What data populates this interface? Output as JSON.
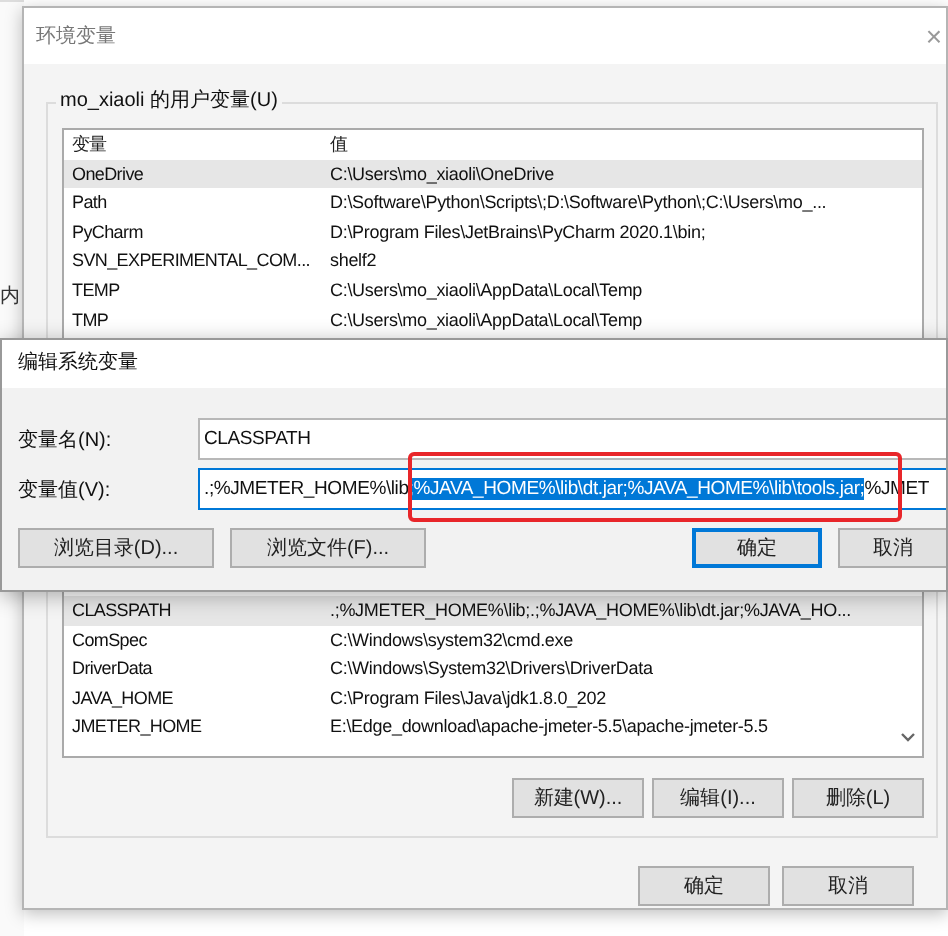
{
  "background_window": {
    "text": "内"
  },
  "env_window": {
    "title": "环境变量",
    "close": "×",
    "user_group": {
      "label": "mo_xiaoli 的用户变量(U)",
      "columns": [
        "变量",
        "值"
      ],
      "rows": [
        {
          "name": "OneDrive",
          "value": "C:\\Users\\mo_xiaoli\\OneDrive",
          "selected": true
        },
        {
          "name": "Path",
          "value": "D:\\Software\\Python\\Scripts\\;D:\\Software\\Python\\;C:\\Users\\mo_...",
          "selected": false
        },
        {
          "name": "PyCharm",
          "value": "D:\\Program Files\\JetBrains\\PyCharm 2020.1\\bin;",
          "selected": false
        },
        {
          "name": "SVN_EXPERIMENTAL_COM...",
          "value": "shelf2",
          "selected": false
        },
        {
          "name": "TEMP",
          "value": "C:\\Users\\mo_xiaoli\\AppData\\Local\\Temp",
          "selected": false
        },
        {
          "name": "TMP",
          "value": "C:\\Users\\mo_xiaoli\\AppData\\Local\\Temp",
          "selected": false
        }
      ]
    },
    "system_group": {
      "rows": [
        {
          "name": "CLASSPATH",
          "value": ".;%JMETER_HOME%\\lib;.;%JAVA_HOME%\\lib\\dt.jar;%JAVA_HO...",
          "selected": true
        },
        {
          "name": "ComSpec",
          "value": "C:\\Windows\\system32\\cmd.exe",
          "selected": false
        },
        {
          "name": "DriverData",
          "value": "C:\\Windows\\System32\\Drivers\\DriverData",
          "selected": false
        },
        {
          "name": "JAVA_HOME",
          "value": "C:\\Program Files\\Java\\jdk1.8.0_202",
          "selected": false
        },
        {
          "name": "JMETER_HOME",
          "value": "E:\\Edge_download\\apache-jmeter-5.5\\apache-jmeter-5.5",
          "selected": false
        }
      ],
      "buttons": [
        "新建(W)...",
        "编辑(I)...",
        "删除(L)"
      ]
    },
    "buttons": [
      "确定",
      "取消"
    ]
  },
  "edit_dialog": {
    "title": "编辑系统变量",
    "name_field": {
      "label": "变量名(N):",
      "value": "CLASSPATH"
    },
    "value_field": {
      "label": "变量值(V):",
      "segments": [
        {
          "text": ".;%JMETER_HOME%\\lib",
          "selected": false
        },
        {
          "text": ";%JAVA_HOME%\\lib\\dt.jar;%JAVA_HOME%\\lib\\tools.jar;",
          "selected": true
        },
        {
          "text": "%JMET",
          "selected": false
        }
      ]
    },
    "buttons": [
      {
        "label": "浏览目录(D)...",
        "default": false
      },
      {
        "label": "浏览文件(F)...",
        "default": false
      },
      {
        "label": "确定",
        "default": true
      },
      {
        "label": "取消",
        "default": false
      }
    ]
  }
}
